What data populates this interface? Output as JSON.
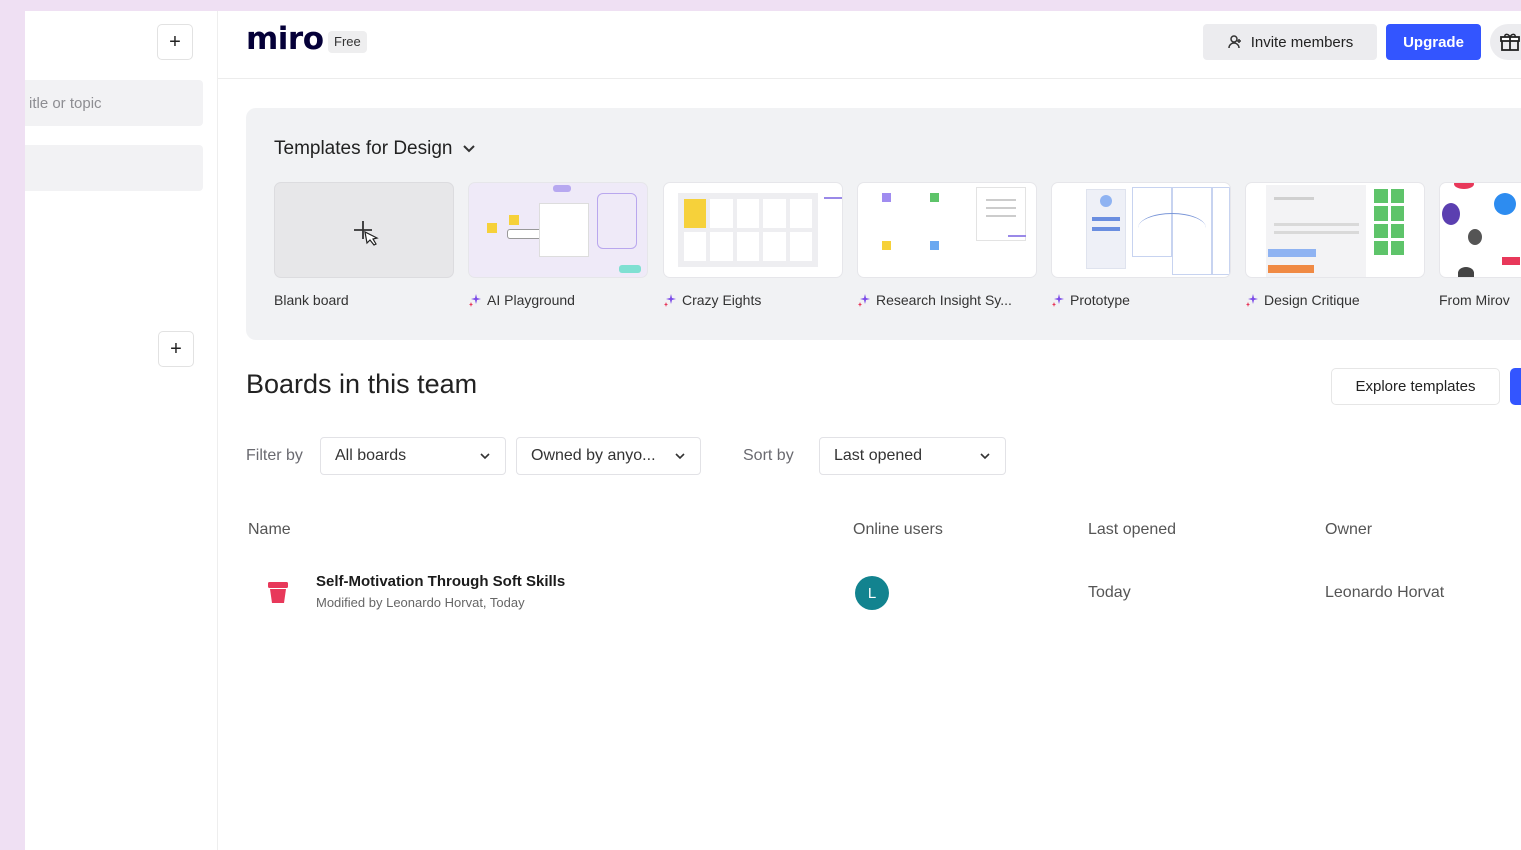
{
  "sidebar": {
    "search_placeholder": "itle or topic",
    "add_label": "+",
    "add_team_label": "+"
  },
  "header": {
    "logo": "miro",
    "plan": "Free",
    "invite_label": "Invite members",
    "upgrade_label": "Upgrade"
  },
  "templates": {
    "heading": "Templates for Design",
    "items": [
      {
        "label": "Blank board",
        "ai": false
      },
      {
        "label": "AI Playground",
        "ai": true
      },
      {
        "label": "Crazy Eights",
        "ai": true
      },
      {
        "label": "Research Insight Sy...",
        "ai": true
      },
      {
        "label": "Prototype",
        "ai": true
      },
      {
        "label": "Design Critique",
        "ai": true
      },
      {
        "label": "From Mirov",
        "ai": false
      }
    ]
  },
  "boards": {
    "title": "Boards in this team",
    "explore_label": "Explore templates",
    "filter_label": "Filter by",
    "filter_boards": "All boards",
    "filter_owner": "Owned by anyo...",
    "sort_label": "Sort by",
    "sort_value": "Last opened",
    "columns": {
      "name": "Name",
      "online": "Online users",
      "last_opened": "Last opened",
      "owner": "Owner"
    },
    "rows": [
      {
        "name": "Self-Motivation Through Soft Skills",
        "meta": "Modified by Leonardo Horvat, Today",
        "avatar_initial": "L",
        "last_opened": "Today",
        "owner": "Leonardo Horvat"
      }
    ]
  },
  "colors": {
    "accent": "#3355ff",
    "avatar": "#12838f",
    "board_icon": "#e8385a"
  }
}
